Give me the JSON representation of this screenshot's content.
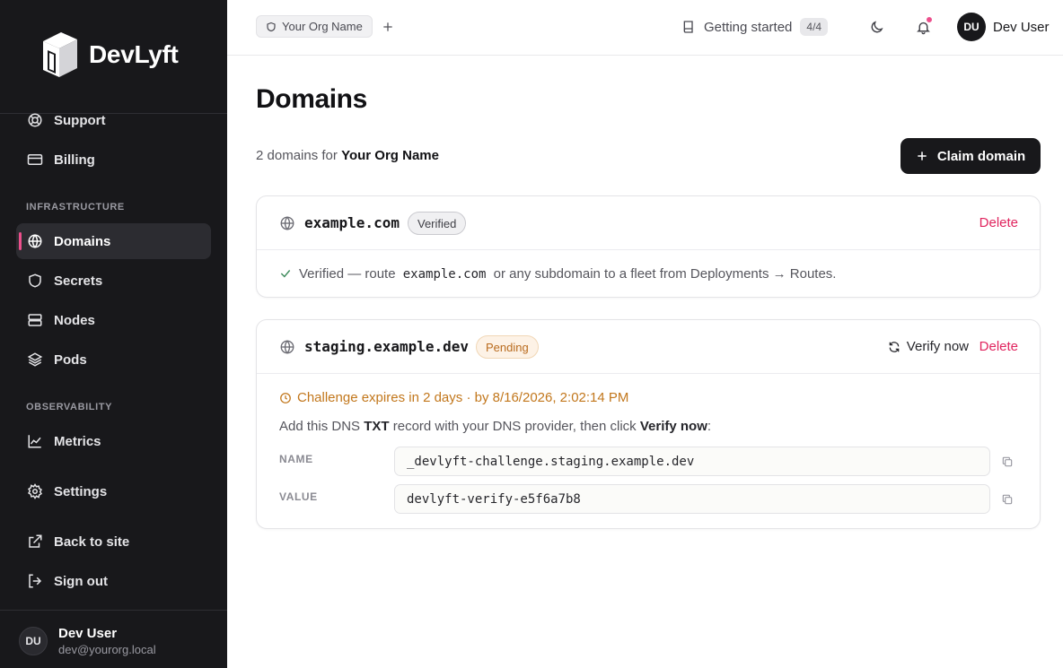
{
  "sidebar": {
    "logo_text": "DevLyft",
    "items_top": [
      {
        "label": "Support",
        "icon": "lifebuoy-icon"
      },
      {
        "label": "Billing",
        "icon": "credit-card-icon"
      }
    ],
    "section_infra": "INFRASTRUCTURE",
    "items_infra": [
      {
        "label": "Domains",
        "icon": "globe-icon",
        "active": true
      },
      {
        "label": "Secrets",
        "icon": "shield-icon"
      },
      {
        "label": "Nodes",
        "icon": "server-icon"
      },
      {
        "label": "Pods",
        "icon": "layers-icon"
      }
    ],
    "section_obs": "OBSERVABILITY",
    "items_obs": [
      {
        "label": "Metrics",
        "icon": "chart-icon"
      }
    ],
    "settings": {
      "label": "Settings",
      "icon": "gear-icon"
    },
    "back_to_site": {
      "label": "Back to site",
      "icon": "external-link-icon"
    },
    "sign_out": {
      "label": "Sign out",
      "icon": "sign-out-icon"
    },
    "user": {
      "initials": "DU",
      "name": "Dev User",
      "email": "dev@yourorg.local"
    }
  },
  "topbar": {
    "org_name": "Your Org Name",
    "getting_started": "Getting started",
    "progress": "4/4",
    "user": {
      "initials": "DU",
      "name": "Dev User"
    }
  },
  "main": {
    "title": "Domains",
    "count_text": "2 domains for",
    "org_name": "Your Org Name",
    "claim_button": "Claim domain",
    "domains": [
      {
        "name": "example.com",
        "status": "Verified",
        "delete": "Delete",
        "note_prefix": "Verified — route",
        "note_domain": "example.com",
        "note_suffix": "or any subdomain to a fleet from Deployments → Routes."
      },
      {
        "name": "staging.example.dev",
        "status": "Pending",
        "verify_now": "Verify now",
        "delete": "Delete",
        "challenge": "Challenge expires in 2 days · by 8/16/2026, 2:02:14 PM",
        "instr_prefix": "Add this DNS",
        "instr_type": "TXT",
        "instr_middle": "record with your DNS provider, then click",
        "instr_action": "Verify now",
        "instr_suffix": ":",
        "record": {
          "name_label": "NAME",
          "name_value": "_devlyft-challenge.staging.example.dev",
          "value_label": "VALUE",
          "value_value": "devlyft-verify-e5f6a7b8"
        }
      }
    ]
  },
  "colors": {
    "sidebar_bg": "#18181b",
    "accent_pink": "#ec4f8c",
    "delete_red": "#e0245e",
    "pending_amber": "#c2771c",
    "verified_green": "#3c8a5a"
  }
}
